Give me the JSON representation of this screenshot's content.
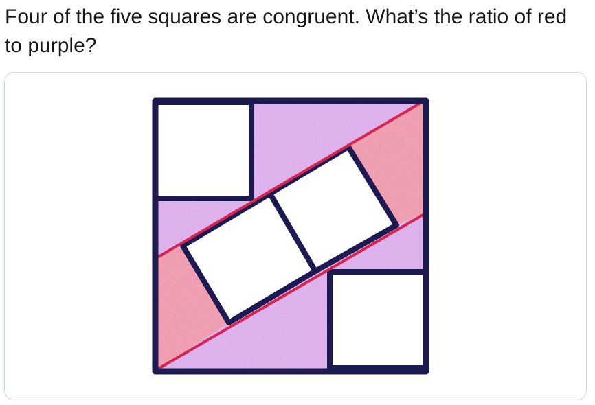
{
  "tweet": {
    "text": "Four of the five squares are congruent. What’s the ratio of red to purple?"
  },
  "figure": {
    "colors": {
      "outline": "#1d1a52",
      "purple_fill": "#d59be8",
      "red_fill": "#ec7f9a",
      "red_line": "#d8234f",
      "square_fill": "#ffffff"
    }
  }
}
